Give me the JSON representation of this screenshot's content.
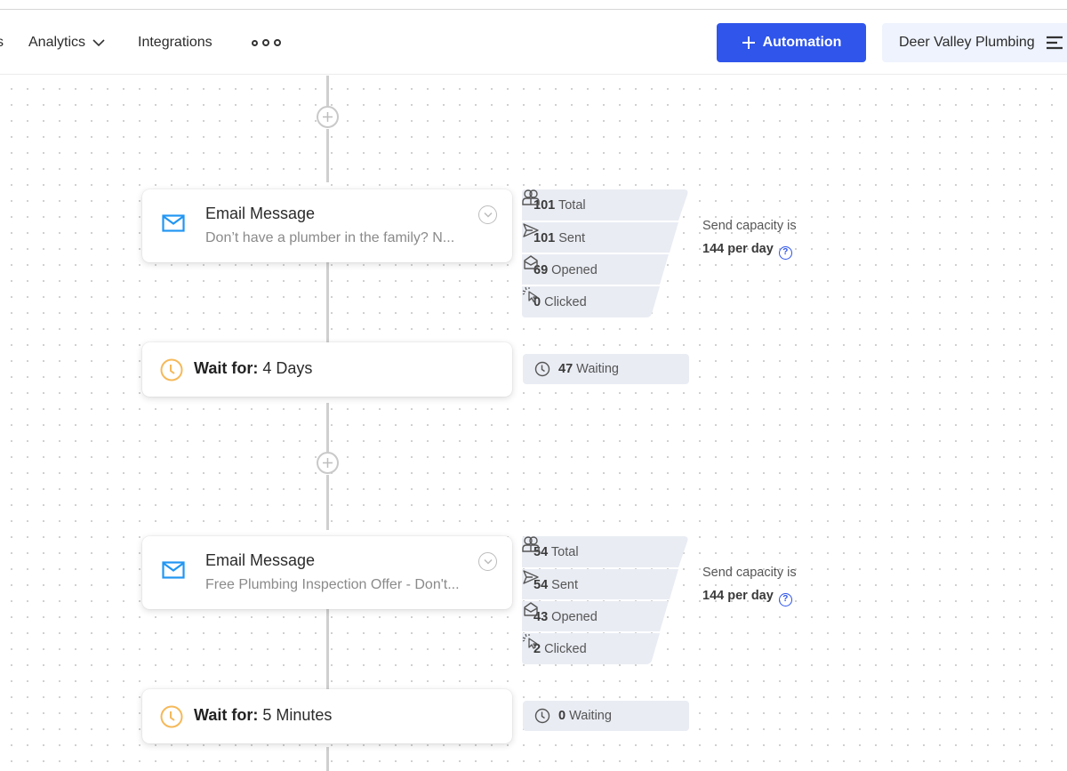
{
  "nav": {
    "partial_label": "s",
    "items": [
      {
        "label": "Analytics",
        "has_dropdown": true
      },
      {
        "label": "Integrations"
      }
    ],
    "more_icon": "more-dots-icon"
  },
  "header_actions": {
    "automation_button": "Automation",
    "account_name": "Deer Valley Plumbing"
  },
  "workflow": {
    "steps": [
      {
        "type": "email",
        "title": "Email Message",
        "subtitle": "Don’t have a plumber in the family? N...",
        "stats": [
          {
            "icon": "users-icon",
            "value": "101",
            "label": "Total"
          },
          {
            "icon": "send-icon",
            "value": "101",
            "label": "Sent"
          },
          {
            "icon": "opened-envelope-icon",
            "value": "69",
            "label": "Opened"
          },
          {
            "icon": "click-cursor-icon",
            "value": "0",
            "label": "Clicked"
          }
        ],
        "capacity_prefix": "Send capacity is",
        "capacity_value": "144 per day"
      },
      {
        "type": "wait",
        "label": "Wait for:",
        "duration": "4 Days",
        "waiting_value": "47",
        "waiting_label": "Waiting"
      },
      {
        "type": "email",
        "title": "Email Message",
        "subtitle": "Free Plumbing Inspection Offer - Don't...",
        "stats": [
          {
            "icon": "users-icon",
            "value": "54",
            "label": "Total"
          },
          {
            "icon": "send-icon",
            "value": "54",
            "label": "Sent"
          },
          {
            "icon": "opened-envelope-icon",
            "value": "43",
            "label": "Opened"
          },
          {
            "icon": "click-cursor-icon",
            "value": "2",
            "label": "Clicked"
          }
        ],
        "capacity_prefix": "Send capacity is",
        "capacity_value": "144 per day"
      },
      {
        "type": "wait",
        "label": "Wait for:",
        "duration": "5 Minutes",
        "waiting_value": "0",
        "waiting_label": "Waiting"
      }
    ]
  },
  "colors": {
    "primary": "#2f55eb",
    "email_icon": "#2196f3",
    "clock_icon": "#f5b95a",
    "stats_bg": "#e9ecf3"
  }
}
